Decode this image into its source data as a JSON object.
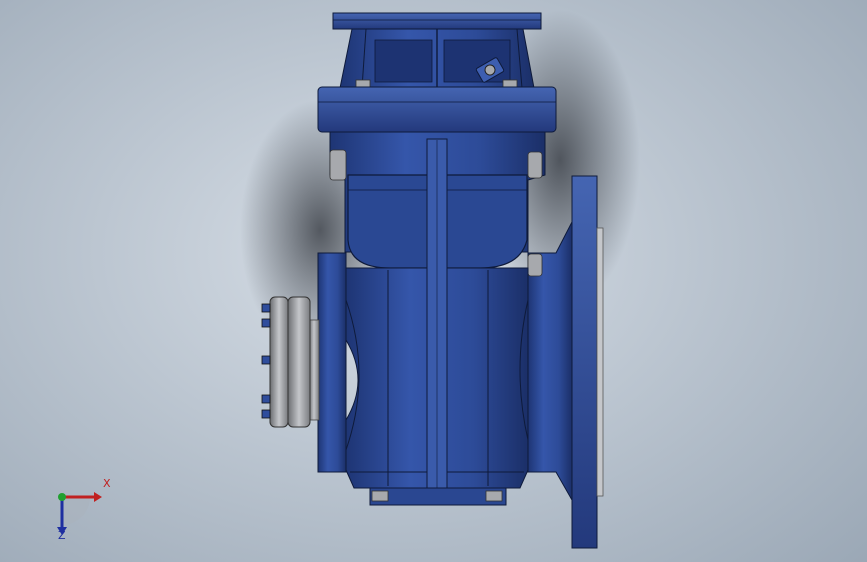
{
  "viewport": {
    "background_top": "#d8dfe7",
    "background_edge": "#9ba8b6"
  },
  "model": {
    "body_color": "#2f4d9c",
    "body_dark": "#1e3574",
    "body_light": "#4a68b8",
    "steel_color": "#a7a9ad",
    "steel_dark": "#6c6e72"
  },
  "triad": {
    "x_label": "X",
    "z_label": "Z",
    "x_color": "#c02020",
    "y_color": "#20a030",
    "z_color": "#1e2fa0"
  }
}
